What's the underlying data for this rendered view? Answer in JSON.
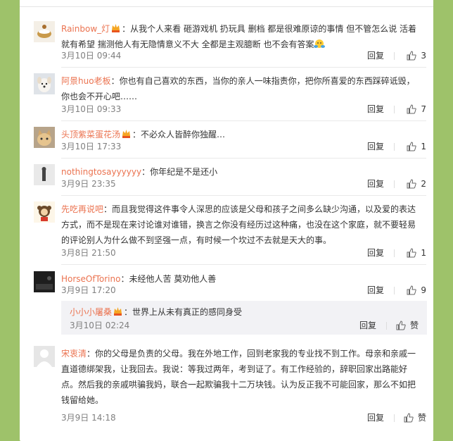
{
  "comments": [
    {
      "user": "Rainbow_灯",
      "vip": true,
      "text": "从我个人来看 砸游戏机 扔玩具 删档 都是很难原谅的事情 但不管怎么说 活着就有希望 揣测他人有无隐情意义不大 全都是主观臆断 也不会有答案",
      "emoji": "hug-emoji",
      "time": "3月10日 09:44",
      "reply": "回复",
      "likes": "3"
    },
    {
      "user": "阿景huo老板",
      "vip": false,
      "text": "你也有自己喜欢的东西，当你的亲人一味指责你，把你所喜爱的东西踩碎诋毁，你也会不开心吧……",
      "time": "3月10日 09:33",
      "reply": "回复",
      "likes": "7"
    },
    {
      "user": "头顶紫菜蛋花汤",
      "vip": true,
      "text": "不必众人皆醉你独醒…",
      "time": "3月10日 17:33",
      "reply": "回复",
      "likes": "1"
    },
    {
      "user": "nothingtosayyyyyy",
      "vip": false,
      "text": "你年纪是不是还小",
      "time": "3月9日 23:35",
      "reply": "回复",
      "likes": "2"
    },
    {
      "user": "先吃再说吧",
      "vip": false,
      "text": "而且我觉得这件事令人深思的应该是父母和孩子之间多么缺少沟通，以及爱的表达方式，而不是现在来讨论谁对谁错，换言之你没有经历过这种痛，也没在这个家庭，就不要轻易的评论别人为什么做不到坚强一点，有时候一个坎过不去就是天大的事。",
      "time": "3月8日 21:50",
      "reply": "回复",
      "likes": "1"
    },
    {
      "user": "HorseOfTorino",
      "vip": false,
      "text": "未经他人苦 莫劝他人善",
      "time": "3月9日 17:20",
      "reply": "回复",
      "likes": "9"
    },
    {
      "user": "宋衷清",
      "vip": false,
      "text": "你的父母是负责的父母。我在外地工作，回到老家我的专业找不到工作。母亲和亲戚一直道德绑架我，让我回去。我说：等我过两年，考到证了。有工作经验的，辞职回家出路能好点。然后我的亲戚哄骗我妈，联合一起欺骗我十二万块钱。认为反正我不可能回家，那么不如把钱留给她。",
      "time": "3月9日 14:18",
      "reply": "回复",
      "likes": "赞"
    }
  ],
  "nested_reply": {
    "user": "小小小屠桑",
    "vip": true,
    "text": "世界上从未有真正的感同身受",
    "time": "3月10日 02:24",
    "reply": "回复",
    "likes": "赞"
  },
  "colors": {
    "background": "#9ec26a",
    "username": "#eb7350",
    "text": "#333333",
    "meta": "#808080"
  }
}
